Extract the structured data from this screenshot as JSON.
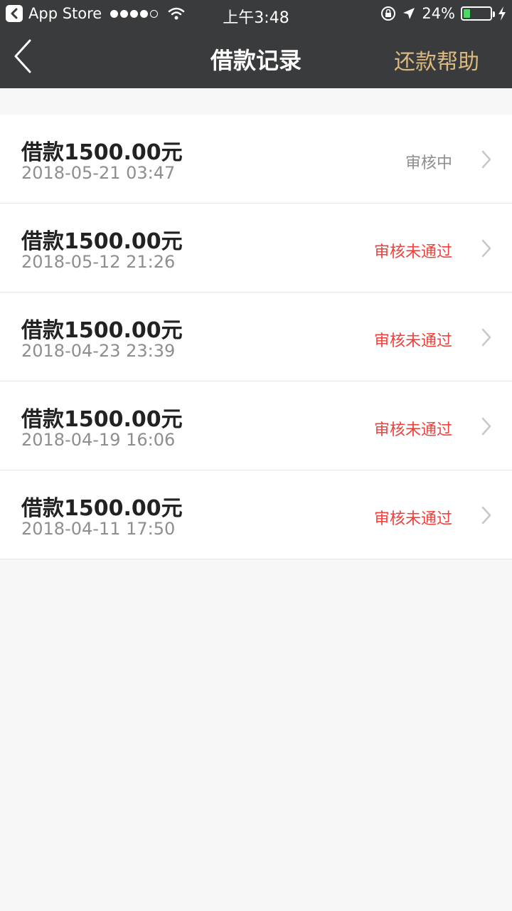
{
  "statusbar": {
    "back_app_label": "App Store",
    "time": "上午3:48",
    "battery_text": "24%",
    "battery_level": 0.24
  },
  "navbar": {
    "title": "借款记录",
    "help_label": "还款帮助"
  },
  "records": [
    {
      "amount": "借款1500.00元",
      "date": "2018-05-21 03:47",
      "status": "审核中",
      "status_color": "#8e8e8e"
    },
    {
      "amount": "借款1500.00元",
      "date": "2018-05-12 21:26",
      "status": "审核未通过",
      "status_color": "#f0413c"
    },
    {
      "amount": "借款1500.00元",
      "date": "2018-04-23 23:39",
      "status": "审核未通过",
      "status_color": "#f0413c"
    },
    {
      "amount": "借款1500.00元",
      "date": "2018-04-19 16:06",
      "status": "审核未通过",
      "status_color": "#f0413c"
    },
    {
      "amount": "借款1500.00元",
      "date": "2018-04-11 17:50",
      "status": "审核未通过",
      "status_color": "#f0413c"
    }
  ],
  "colors": {
    "header_bg": "#3a3b3c",
    "accent_gold": "#d9b97f",
    "reject_red": "#f0413c",
    "pending_gray": "#8e8e8e"
  }
}
